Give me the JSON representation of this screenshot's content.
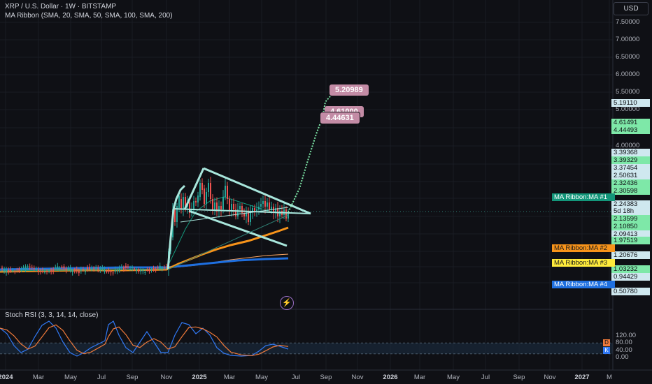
{
  "header": {
    "title": "XRP / U.S. Dollar · 1W · BITSTAMP",
    "indicator": "MA Ribbon (SMA, 20, SMA, 50, SMA, 100, SMA, 200)",
    "currency": "USD"
  },
  "price_axis": {
    "ticks": [
      {
        "label": "7.50000",
        "value": 7.5
      },
      {
        "label": "7.00000",
        "value": 7.0
      },
      {
        "label": "6.50000",
        "value": 6.5
      },
      {
        "label": "6.00000",
        "value": 6.0
      },
      {
        "label": "5.50000",
        "value": 5.5
      },
      {
        "label": "5.00000",
        "value": 5.0
      },
      {
        "label": "4.00000",
        "value": 4.0
      }
    ]
  },
  "price_tags": [
    {
      "label": "5.19110",
      "value": 5.1911,
      "color": "#cfe8ef"
    },
    {
      "label": "4.61491",
      "value": 4.61491,
      "color": "#7ee8a8"
    },
    {
      "label": "4.44493",
      "value": 4.44493,
      "color": "#7ee8a8"
    },
    {
      "label": "3.39368",
      "value": 3.39368,
      "color": "#cfe8ef"
    },
    {
      "label": "3.39329",
      "value": 3.39329,
      "color": "#7ee8a8"
    },
    {
      "label": "3.37454",
      "value": 3.37454,
      "color": "#cfe8ef"
    },
    {
      "label": "2.50631",
      "value": 2.50631,
      "color": "#cfe8ef"
    },
    {
      "label": "2.32436",
      "value": 2.32436,
      "color": "#7ee8a8"
    },
    {
      "label": "2.30598",
      "value": 2.30598,
      "color": "#7ee8a8"
    },
    {
      "label": "2.24383",
      "value": 2.24383,
      "color": "#cfe8ef"
    },
    {
      "label": "5d 18h",
      "value": 2.2,
      "color": "#cfe8ef"
    },
    {
      "label": "2.13599",
      "value": 2.13599,
      "color": "#7ee8a8"
    },
    {
      "label": "2.10850",
      "value": 2.1085,
      "color": "#7ee8a8"
    },
    {
      "label": "2.09413",
      "value": 2.09413,
      "color": "#cfe8ef"
    },
    {
      "label": "1.97519",
      "value": 1.97519,
      "color": "#7ee8a8"
    },
    {
      "label": "1.20676",
      "value": 1.20676,
      "color": "#cfe8ef"
    },
    {
      "label": "1.03232",
      "value": 1.03232,
      "color": "#7ee8a8"
    },
    {
      "label": "0.94429",
      "value": 0.94429,
      "color": "#cfe8ef"
    },
    {
      "label": "0.50780",
      "value": 0.5078,
      "color": "#cfe8ef"
    }
  ],
  "ma_tags": [
    {
      "label": "MA Ribbon:MA #1",
      "bg": "#13967a",
      "fg": "#ffffff"
    },
    {
      "label": "MA Ribbon:MA #2",
      "bg": "#f7931a",
      "fg": "#1a1a1a"
    },
    {
      "label": "MA Ribbon:MA #3",
      "bg": "#ffeb3b",
      "fg": "#1a1a1a"
    },
    {
      "label": "MA Ribbon:MA #4",
      "bg": "#1e6fe0",
      "fg": "#ffffff"
    }
  ],
  "target_labels": [
    {
      "label": "5.20989"
    },
    {
      "label": "4.61000"
    },
    {
      "label": "4.44631"
    }
  ],
  "stoch": {
    "title": "Stoch RSI (3, 3, 14, 14, close)",
    "ticks": [
      {
        "label": "120.00",
        "value": 120
      },
      {
        "label": "80.00",
        "value": 80
      },
      {
        "label": "40.00",
        "value": 40
      },
      {
        "label": "0.00",
        "value": 0
      }
    ],
    "band": [
      20,
      80
    ],
    "badge_d": "D",
    "badge_k": "K"
  },
  "time_axis": [
    {
      "label": "2024",
      "bold": true
    },
    {
      "label": "Mar",
      "bold": false
    },
    {
      "label": "May",
      "bold": false
    },
    {
      "label": "Jul",
      "bold": false
    },
    {
      "label": "Sep",
      "bold": false
    },
    {
      "label": "Nov",
      "bold": false
    },
    {
      "label": "2025",
      "bold": true
    },
    {
      "label": "Mar",
      "bold": false
    },
    {
      "label": "May",
      "bold": false
    },
    {
      "label": "Jul",
      "bold": false
    },
    {
      "label": "Sep",
      "bold": false
    },
    {
      "label": "Nov",
      "bold": false
    },
    {
      "label": "2026",
      "bold": true
    },
    {
      "label": "Mar",
      "bold": false
    },
    {
      "label": "May",
      "bold": false
    },
    {
      "label": "Jul",
      "bold": false
    },
    {
      "label": "Sep",
      "bold": false
    },
    {
      "label": "Nov",
      "bold": false
    },
    {
      "label": "2027",
      "bold": true
    },
    {
      "label": "M",
      "bold": false
    }
  ],
  "colors": {
    "background": "#0f1015",
    "up": "#26a69a",
    "down": "#ef5350",
    "pattern": "#a8e6dc",
    "projection": "#7ee8a8",
    "ma1": "#13967a",
    "ma2": "#f7931a",
    "ma3": "#f4a261",
    "ma4": "#1e6fe0",
    "stoch_k": "#3179f5",
    "stoch_d": "#f07a3a",
    "target_bubble": "#c38ba5"
  }
}
